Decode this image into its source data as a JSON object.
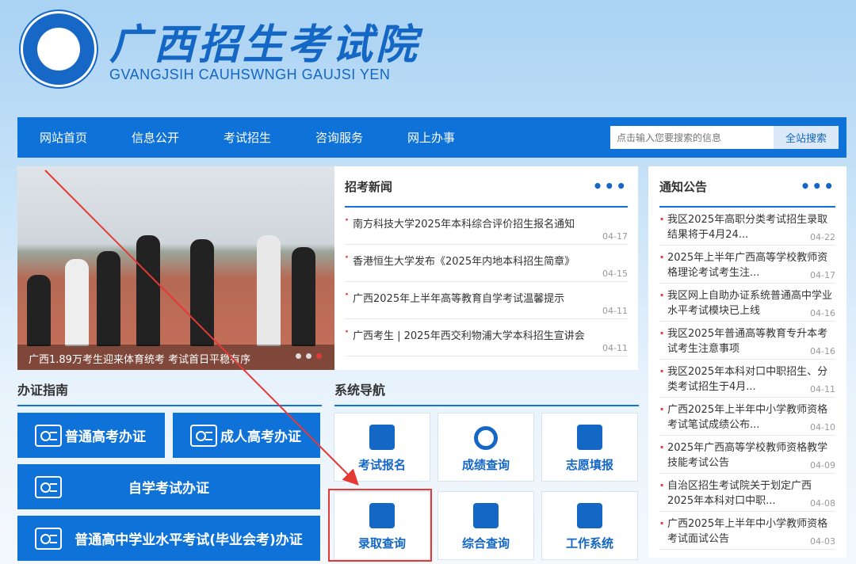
{
  "header": {
    "title": "广西招生考试院",
    "subtitle": "GVANGJSIH CAUHSWNGH GAUJSI YEN"
  },
  "nav": {
    "items": [
      "网站首页",
      "信息公开",
      "考试招生",
      "咨询服务",
      "网上办事"
    ],
    "search_placeholder": "点击输入您要搜索的信息",
    "search_button": "全站搜索"
  },
  "banner": {
    "caption": "广西1.89万考生迎来体育统考 考试首日平稳有序"
  },
  "news": {
    "title": "招考新闻",
    "items": [
      {
        "title": "南方科技大学2025年本科综合评价招生报名通知",
        "date": "04-17"
      },
      {
        "title": "香港恒生大学发布《2025年内地本科招生简章》",
        "date": "04-15"
      },
      {
        "title": "广西2025年上半年高等教育自学考试温馨提示",
        "date": "04-11"
      },
      {
        "title": "广西考生 | 2025年西交利物浦大学本科招生宣讲会",
        "date": "04-11"
      }
    ]
  },
  "notice": {
    "title": "通知公告",
    "items": [
      {
        "title": "我区2025年高职分类考试招生录取结果将于4月24...",
        "date": "04-22"
      },
      {
        "title": "2025年上半年广西高等学校教师资格理论考试考生注...",
        "date": "04-17"
      },
      {
        "title": "我区网上自助办证系统普通高中学业水平考试模块已上线",
        "date": "04-16"
      },
      {
        "title": "我区2025年普通高等教育专升本考试考生注意事项",
        "date": "04-16"
      },
      {
        "title": "我区2025年本科对口中职招生、分类考试招生于4月...",
        "date": "04-11"
      },
      {
        "title": "广西2025年上半年中小学教师资格考试笔试成绩公布...",
        "date": "04-10"
      },
      {
        "title": "2025年广西高等学校教师资格教学技能考试公告",
        "date": "04-09"
      },
      {
        "title": "自治区招生考试院关于划定广西2025年本科对口中职...",
        "date": "04-08"
      },
      {
        "title": "广西2025年上半年中小学教师资格考试面试公告",
        "date": "04-03"
      }
    ]
  },
  "guide": {
    "title": "办证指南",
    "buttons": [
      "普通高考办证",
      "成人高考办证",
      "自学考试办证",
      "普通高中学业水平考试(毕业会考)办证"
    ]
  },
  "system": {
    "title": "系统导航",
    "tiles": [
      "考试报名",
      "成绩查询",
      "志愿填报",
      "录取查询",
      "综合查询",
      "工作系统"
    ]
  },
  "colors": {
    "primary": "#0f72d9",
    "highlight": "#e53935"
  }
}
